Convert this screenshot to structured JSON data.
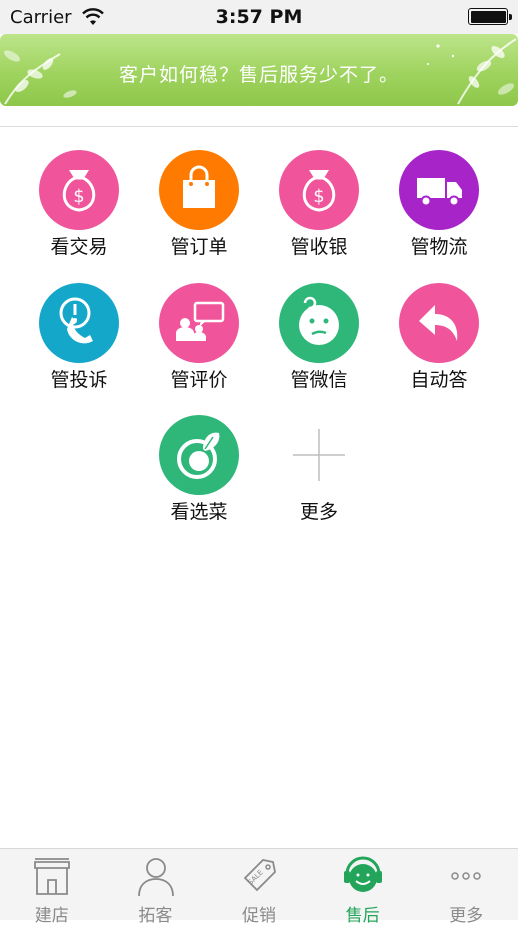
{
  "status_bar": {
    "carrier": "Carrier",
    "time": "3:57 PM"
  },
  "banner": {
    "text": "客户如何稳？售后服务少不了。"
  },
  "grid": [
    {
      "label": "看交易",
      "icon": "money-bag-icon",
      "color": "#f0559b"
    },
    {
      "label": "管订单",
      "icon": "shopping-bag-icon",
      "color": "#ff7a00"
    },
    {
      "label": "管收银",
      "icon": "money-bag-icon",
      "color": "#f0559b"
    },
    {
      "label": "管物流",
      "icon": "truck-icon",
      "color": "#a724c9"
    },
    {
      "label": "管投诉",
      "icon": "complaint-phone-icon",
      "color": "#14a7c9"
    },
    {
      "label": "管评价",
      "icon": "review-chat-icon",
      "color": "#f0559b"
    },
    {
      "label": "管微信",
      "icon": "confused-face-icon",
      "color": "#2fb77a"
    },
    {
      "label": "自动答",
      "icon": "reply-arrow-icon",
      "color": "#f0559b"
    },
    {
      "label": "看选菜",
      "icon": "vegetable-icon",
      "color": "#2fb77a"
    },
    {
      "label": "更多",
      "icon": "plus-icon",
      "color": "#bdbdbd"
    }
  ],
  "tab_bar": {
    "active_color": "#22a55a",
    "inactive_color": "#8a8a8a",
    "tabs": [
      {
        "label": "建店",
        "icon": "storefront-icon",
        "active": false
      },
      {
        "label": "拓客",
        "icon": "person-icon",
        "active": false
      },
      {
        "label": "促销",
        "icon": "sale-tag-icon",
        "active": false
      },
      {
        "label": "售后",
        "icon": "headset-service-icon",
        "active": true
      },
      {
        "label": "更多",
        "icon": "more-dots-icon",
        "active": false
      }
    ]
  }
}
